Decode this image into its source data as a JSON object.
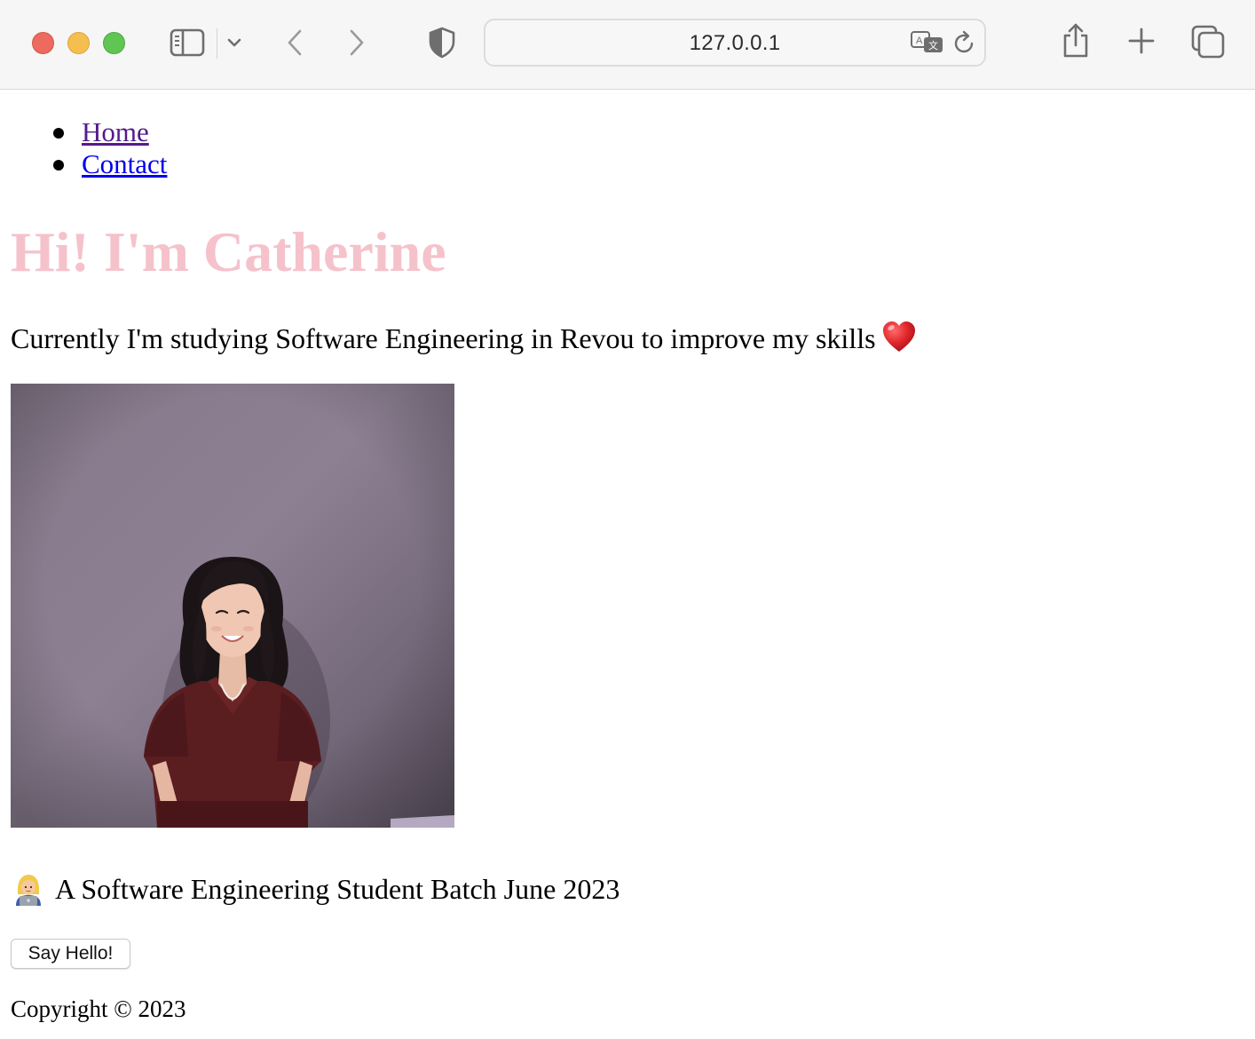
{
  "browser": {
    "url": "127.0.0.1",
    "icons": {
      "close": "close-window-icon",
      "minimize": "minimize-window-icon",
      "zoom": "zoom-window-icon",
      "sidebar": "sidebar-icon",
      "chevron": "chevron-down-icon",
      "back": "back-arrow-icon",
      "forward": "forward-arrow-icon",
      "privacy": "shield-icon",
      "translate": "translate-icon",
      "reload": "reload-icon",
      "share": "share-icon",
      "new_tab": "plus-icon",
      "tabs": "tab-overview-icon"
    },
    "colors": {
      "close": "#ed6a5e",
      "minimize": "#f5bf4f",
      "zoom": "#61c554"
    }
  },
  "nav": {
    "items": [
      {
        "label": "Home",
        "state": "visited"
      },
      {
        "label": "Contact",
        "state": "unvisited"
      }
    ]
  },
  "hero": {
    "title": "Hi! I'm Catherine",
    "title_color": "#f5c2cb"
  },
  "intro": {
    "text": "Currently I'm studying Software Engineering in Revou to improve my skills",
    "emoji_icon": "red-heart-icon"
  },
  "photo": {
    "subject": "portrait-photo"
  },
  "tagline": {
    "emoji_icon": "technologist-icon",
    "text": "A Software Engineering Student Batch June 2023"
  },
  "actions": {
    "hello_label": "Say Hello!"
  },
  "footer": {
    "text": "Copyright © 2023"
  }
}
